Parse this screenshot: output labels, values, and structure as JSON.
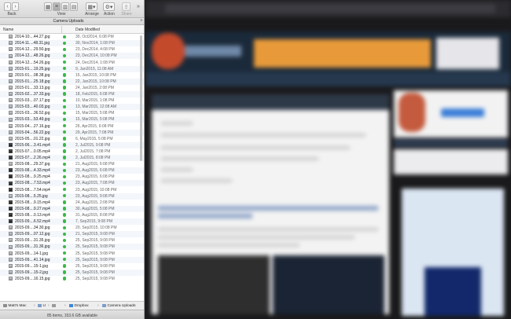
{
  "toolbar": {
    "back_label": "Back",
    "view_label": "View",
    "arrange_label": "Arrange",
    "action_label": "Action",
    "share_label": "Share"
  },
  "folder_title": "Camera Uploads",
  "columns": {
    "name": "Name",
    "date_modified": "Date Modified"
  },
  "files": [
    {
      "name": "2014-10....44.27.jpg",
      "date": "30, Oct2014, 6:08 PM",
      "type": "image"
    },
    {
      "name": "2014-11....48.31.jpg",
      "date": "30, Nov2014, 1:08 PM",
      "type": "image"
    },
    {
      "name": "2014-12....29.50.jpg",
      "date": "23, Dec2014, 4:08 PM",
      "type": "image"
    },
    {
      "name": "2014-12....48.26.jpg",
      "date": "23, Dec2014, 10:08 PM",
      "type": "image"
    },
    {
      "name": "2014-12....54.26.jpg",
      "date": "24, Dec2014, 1:08 PM",
      "type": "image"
    },
    {
      "name": "2015-01....19.25.jpg",
      "date": "9, Jan2015, 11:08 AM",
      "type": "image"
    },
    {
      "name": "2015-01....08.38.jpg",
      "date": "15, Jan2015, 10:08 PM",
      "type": "image"
    },
    {
      "name": "2015-01....25.18.jpg",
      "date": "22, Jan2015, 10:08 PM",
      "type": "image"
    },
    {
      "name": "2015-01....33.13.jpg",
      "date": "24, Jan2015, 2:08 PM",
      "type": "image"
    },
    {
      "name": "2015-02....37.33.jpg",
      "date": "18, Feb2015, 6:08 PM",
      "type": "image"
    },
    {
      "name": "2015-03....07.17.jpg",
      "date": "10, Mar2015, 1:08 PM",
      "type": "image"
    },
    {
      "name": "2015-03....40.03.jpg",
      "date": "13, Mar2015, 12:08 AM",
      "type": "image"
    },
    {
      "name": "2015-03....36.52.jpg",
      "date": "15, Mar2015, 5:08 PM",
      "type": "image"
    },
    {
      "name": "2015-03....53.49.jpg",
      "date": "15, Mar2015, 5:08 PM",
      "type": "image"
    },
    {
      "name": "2015-04....27.16.jpg",
      "date": "26, Apr2015, 6:08 PM",
      "type": "image"
    },
    {
      "name": "2015-04....56.22.jpg",
      "date": "29, Apr2015, 7:08 PM",
      "type": "image"
    },
    {
      "name": "2015-05....01.22.jpg",
      "date": "6, May2015, 5:08 PM",
      "type": "image"
    },
    {
      "name": "2015-06....3.41.mp4",
      "date": "2, Jul2015, 9:08 PM",
      "type": "video"
    },
    {
      "name": "2015-07....0.05.mp4",
      "date": "2, Jul2015, 7:08 PM",
      "type": "video"
    },
    {
      "name": "2015-07....2.26.mp4",
      "date": "2, Jul2015, 8:08 PM",
      "type": "video"
    },
    {
      "name": "2015-08....29.37.jpg",
      "date": "21, Aug2015, 6:08 PM",
      "type": "image"
    },
    {
      "name": "2015-08....4.33.mp4",
      "date": "23, Aug2015, 6:08 PM",
      "type": "video"
    },
    {
      "name": "2015-08....9.25.mp4",
      "date": "23, Aug2015, 6:08 PM",
      "type": "video"
    },
    {
      "name": "2015-08....7.53.mp4",
      "date": "23, Aug2015, 7:08 PM",
      "type": "video"
    },
    {
      "name": "2015-08....7.54.mp4",
      "date": "23, Aug2015, 10:08 PM",
      "type": "video"
    },
    {
      "name": "2015-08....5.25.jpg",
      "date": "23, Aug2015, 9:08 PM",
      "type": "image"
    },
    {
      "name": "2015-08....9.15.mp4",
      "date": "24, Aug2015, 2:08 PM",
      "type": "video"
    },
    {
      "name": "2015-08....9.27.mp4",
      "date": "30, Aug2015, 5:08 PM",
      "type": "video"
    },
    {
      "name": "2015-08....0.13.mp4",
      "date": "31, Aug2015, 8:08 PM",
      "type": "video"
    },
    {
      "name": "2015-09....6.52.mp4",
      "date": "7, Sep2015, 9:08 PM",
      "type": "video"
    },
    {
      "name": "2015-09....34.30.jpg",
      "date": "20, Sep2015, 10:08 PM",
      "type": "image"
    },
    {
      "name": "2015-09....07.12.jpg",
      "date": "21, Sep2015, 9:08 PM",
      "type": "image"
    },
    {
      "name": "2015-09....31.35.jpg",
      "date": "25, Sep2015, 9:08 PM",
      "type": "image"
    },
    {
      "name": "2015-09....31.36.jpg",
      "date": "25, Sep2015, 9:08 PM",
      "type": "image"
    },
    {
      "name": "2015-09....14-1.jpg",
      "date": "25, Sep2015, 9:08 PM",
      "type": "image"
    },
    {
      "name": "2015-09....41.14.jpg",
      "date": "25, Sep2015, 9:08 PM",
      "type": "image"
    },
    {
      "name": "2015-09....15-1.jpg",
      "date": "25, Sep2015, 9:08 PM",
      "type": "image"
    },
    {
      "name": "2015-09....15-2.jpg",
      "date": "25, Sep2015, 9:08 PM",
      "type": "image"
    },
    {
      "name": "2015-09....16.15.jpg",
      "date": "25, Sep2015, 9:08 PM",
      "type": "image"
    }
  ],
  "path": [
    "Matt's Mac",
    "U",
    "",
    "Dropbox",
    "Camera Uploads"
  ],
  "status": "85 items, 153.6 GB available",
  "colors": {
    "sync": "#3bb84a",
    "row_alt": "#f3f6fa"
  }
}
